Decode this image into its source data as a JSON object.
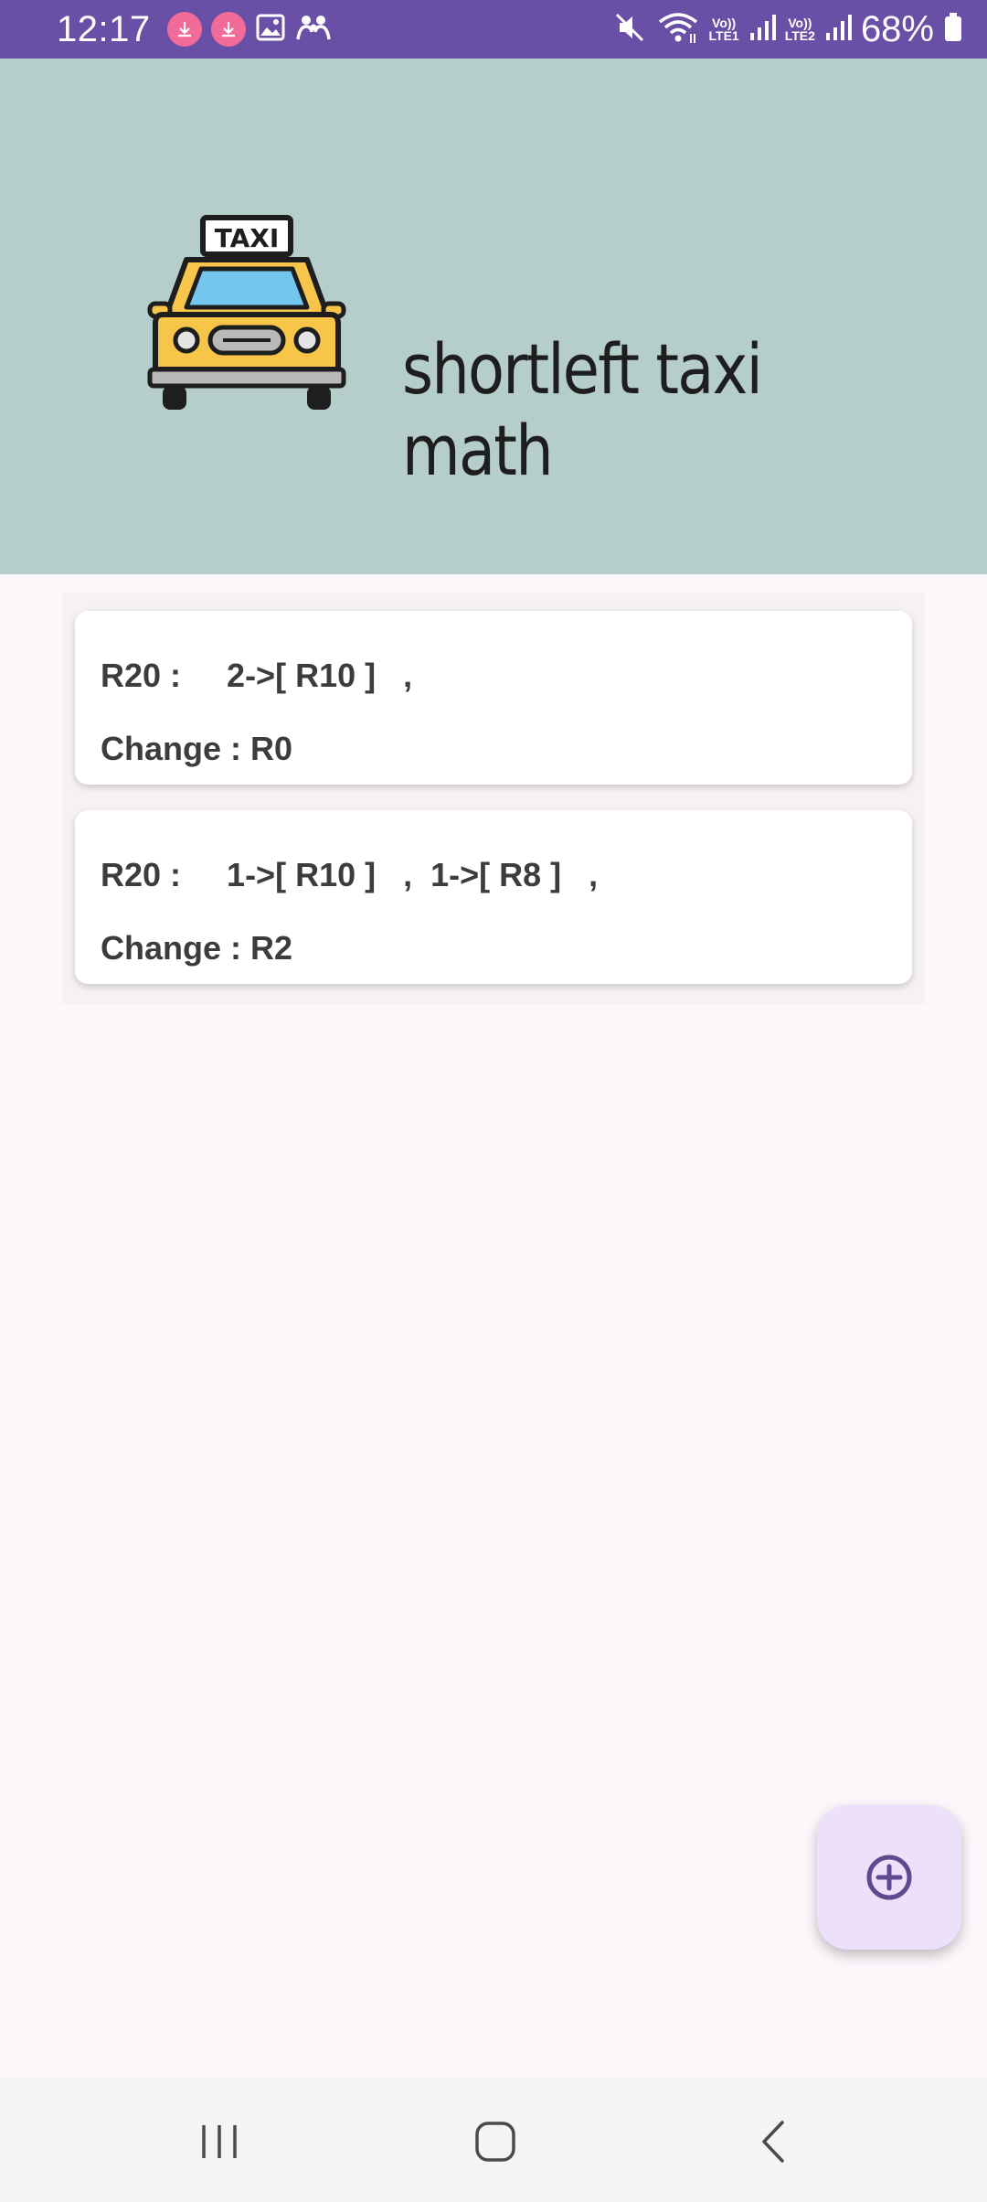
{
  "status_bar": {
    "time": "12:17",
    "battery": "68%",
    "sim1_label": "LTE1",
    "sim2_label": "LTE2",
    "volte_label": "Vo))",
    "icons": [
      "download-icon",
      "download-icon",
      "gallery-icon",
      "family-icon",
      "mute-icon",
      "wifi-icon",
      "signal-icon",
      "signal-icon",
      "battery-icon"
    ],
    "bg_color": "#6a4fa6"
  },
  "header": {
    "title": "shortleft taxi math",
    "logo_sign": "TAXI",
    "bg_color": "#b5cecb"
  },
  "results": [
    {
      "line1": "R20 :     2->[ R10 ]   ,",
      "line2": "Change : R0"
    },
    {
      "line1": "R20 :     1->[ R10 ]   ,  1->[ R8 ]   ,",
      "line2": "Change : R2"
    }
  ],
  "fab": {
    "icon": "add-circle-icon",
    "color": "#ece0fb"
  },
  "nav": {
    "icons": [
      "recents-icon",
      "home-icon",
      "back-icon"
    ]
  }
}
